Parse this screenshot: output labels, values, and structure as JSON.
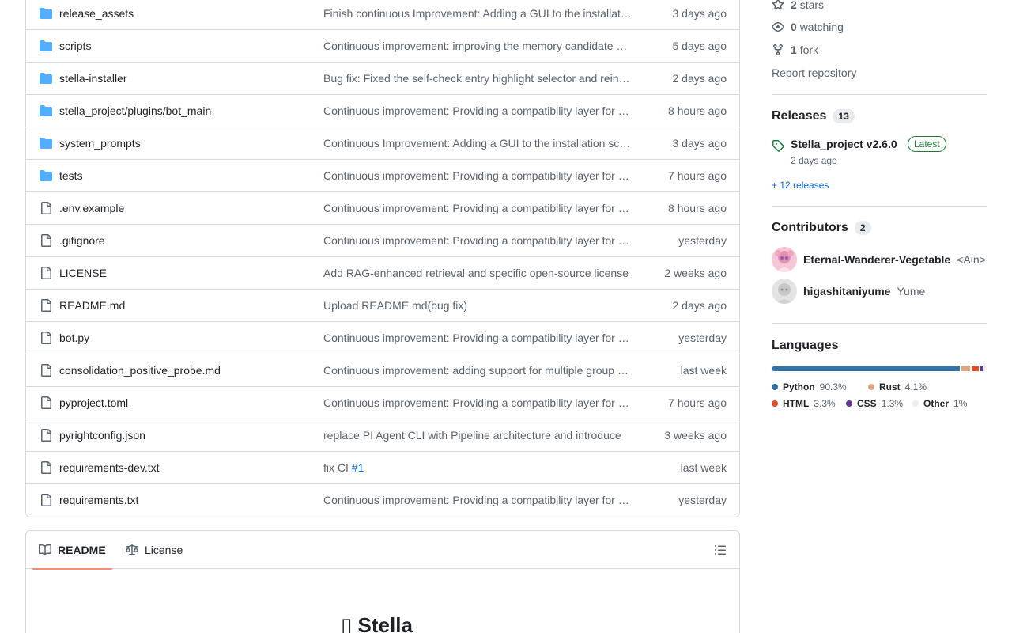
{
  "files": [
    {
      "type": "dir",
      "name": "release_assets",
      "message": "Finish continuous Improvement: Adding a GUI to the installation script",
      "time": "3 days ago"
    },
    {
      "type": "dir",
      "name": "scripts",
      "message": "Continuous improvement: improving the memory candidate generation",
      "time": "5 days ago"
    },
    {
      "type": "dir",
      "name": "stella-installer",
      "message": "Bug fix: Fixed the self-check entry highlight selector and reinstall",
      "time": "2 days ago"
    },
    {
      "type": "dir",
      "name": "stella_project/plugins/bot_main",
      "message": "Continuous improvement: Providing a compatibility layer for plugins",
      "time": "8 hours ago"
    },
    {
      "type": "dir",
      "name": "system_prompts",
      "message": "Continuous Improvement: Adding a GUI to the installation script",
      "time": "3 days ago"
    },
    {
      "type": "dir",
      "name": "tests",
      "message": "Continuous improvement: Providing a compatibility layer for plugins",
      "time": "7 hours ago"
    },
    {
      "type": "file",
      "name": ".env.example",
      "message": "Continuous improvement: Providing a compatibility layer for plugins",
      "time": "8 hours ago"
    },
    {
      "type": "file",
      "name": ".gitignore",
      "message": "Continuous improvement: Providing a compatibility layer for plugins",
      "time": "yesterday"
    },
    {
      "type": "file",
      "name": "LICENSE",
      "message": "Add RAG-enhanced retrieval and specific open-source license",
      "time": "2 weeks ago"
    },
    {
      "type": "file",
      "name": "README.md",
      "message": "Upload README.md(bug fix)",
      "time": "2 days ago"
    },
    {
      "type": "file",
      "name": "bot.py",
      "message": "Continuous improvement: Providing a compatibility layer for plugins",
      "time": "yesterday"
    },
    {
      "type": "file",
      "name": "consolidation_positive_probe.md",
      "message": "Continuous improvement: adding support for multiple group chats",
      "time": "last week"
    },
    {
      "type": "file",
      "name": "pyproject.toml",
      "message": "Continuous improvement: Providing a compatibility layer for plugins",
      "time": "7 hours ago"
    },
    {
      "type": "file",
      "name": "pyrightconfig.json",
      "message": "replace PI Agent CLI with Pipeline architecture and introduce",
      "time": "3 weeks ago"
    },
    {
      "type": "file",
      "name": "requirements-dev.txt",
      "message": "fix CI ",
      "message_link": "#1",
      "time": "last week"
    },
    {
      "type": "file",
      "name": "requirements.txt",
      "message": "Continuous improvement: Providing a compatibility layer for plugins",
      "time": "yesterday"
    }
  ],
  "readme": {
    "tab_readme": "README",
    "tab_license": "License",
    "title": "▯ Stella"
  },
  "sidebar": {
    "stars_count": "2",
    "stars_label": "stars",
    "watching_count": "0",
    "watching_label": "watching",
    "fork_count": "1",
    "fork_label": "fork",
    "report": "Report repository",
    "releases_title": "Releases",
    "releases_count": "13",
    "release_name": "Stella_project v2.6.0",
    "release_badge": "Latest",
    "release_date": "2 days ago",
    "more_releases": "+ 12 releases",
    "contributors_title": "Contributors",
    "contributors_count": "2",
    "contributors": [
      {
        "login": "Eternal-Wanderer-Vegetable",
        "name": "<Ain>"
      },
      {
        "login": "higashitaniyume",
        "name": "Yume"
      }
    ],
    "languages_title": "Languages",
    "languages": [
      {
        "name": "Python",
        "pct": "90.3%",
        "value": 90.3,
        "color": "#3572A5"
      },
      {
        "name": "Rust",
        "pct": "4.1%",
        "value": 4.1,
        "color": "#dea584"
      },
      {
        "name": "HTML",
        "pct": "3.3%",
        "value": 3.3,
        "color": "#e34c26"
      },
      {
        "name": "CSS",
        "pct": "1.3%",
        "value": 1.3,
        "color": "#663399"
      },
      {
        "name": "Other",
        "pct": "1%",
        "value": 1.0,
        "color": "#ededed"
      }
    ]
  }
}
